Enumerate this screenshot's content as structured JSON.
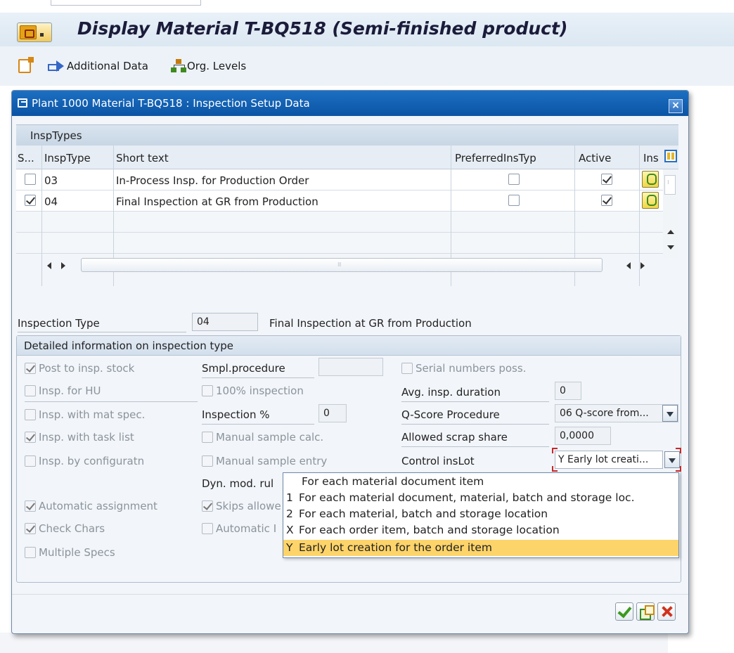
{
  "window": {
    "title": "Display Material T-BQ518 (Semi-finished product)",
    "menu_icon": "sap-menu-icon"
  },
  "toolbar": {
    "items": [
      {
        "icon": "create-document-icon",
        "label": ""
      },
      {
        "icon": "arrow-right-icon",
        "label": "Additional Data"
      },
      {
        "icon": "org-structure-icon",
        "label": "Org. Levels"
      }
    ]
  },
  "dialog": {
    "title": "Plant 1000 Material T-BQ518 : Inspection Setup Data",
    "close_label": "×"
  },
  "table": {
    "title": "InspTypes",
    "columns": [
      "S...",
      "InspType",
      "Short text",
      "PreferredInsTyp",
      "Active",
      "Ins"
    ],
    "rows": [
      {
        "selected": false,
        "insp_type": "03",
        "short_text": "In-Process Insp. for Production Order",
        "preferred": false,
        "active": true
      },
      {
        "selected": true,
        "insp_type": "04",
        "short_text": "Final Inspection at GR from Production",
        "preferred": false,
        "active": true
      }
    ]
  },
  "inspection_type": {
    "label": "Inspection Type",
    "value": "04",
    "description": "Final Inspection at GR from Production"
  },
  "details": {
    "group_title": "Detailed information on inspection type",
    "col1": [
      {
        "label": "Post to insp. stock",
        "checked": true
      },
      {
        "label": "Insp. for HU",
        "checked": false
      },
      {
        "label": "Insp. with mat spec.",
        "checked": false
      },
      {
        "label": "Insp. with task list",
        "checked": true
      },
      {
        "label": "Insp. by configuratn",
        "checked": false
      },
      {
        "label": "Automatic assignment",
        "checked": true
      },
      {
        "label": "Check Chars",
        "checked": true
      },
      {
        "label": "Multiple Specs",
        "checked": false
      }
    ],
    "smpl_procedure": {
      "label": "Smpl.procedure",
      "value": ""
    },
    "inspection_100": {
      "label": "100% inspection",
      "checked": false
    },
    "inspection_pct": {
      "label": "Inspection %",
      "value": "0"
    },
    "manual_sample_calc": {
      "label": "Manual sample calc.",
      "checked": false
    },
    "manual_sample_entry": {
      "label": "Manual sample entry",
      "checked": false
    },
    "dyn_mod_rule": {
      "label": "Dyn. mod. rul"
    },
    "skips_allowed": {
      "label": "Skips allowe",
      "checked": true
    },
    "automatic": {
      "label": "Automatic I",
      "checked": false
    },
    "serial_numbers": {
      "label": "Serial numbers poss.",
      "checked": false
    },
    "avg_insp_duration": {
      "label": "Avg. insp. duration",
      "value": "0"
    },
    "q_score": {
      "label": "Q-Score Procedure",
      "value": "06 Q-score from..."
    },
    "scrap_share": {
      "label": "Allowed scrap share",
      "value": "0,0000"
    },
    "control_inslot": {
      "label": "Control insLot",
      "value": "Y Early lot creati..."
    }
  },
  "control_inslot_options": [
    {
      "key": "",
      "label": "For each material document item",
      "selected": false
    },
    {
      "key": "1",
      "label": "For each material document, material, batch and storage loc.",
      "selected": false
    },
    {
      "key": "2",
      "label": "For each material, batch and storage location",
      "selected": false
    },
    {
      "key": "X",
      "label": "For each order item, batch and storage location",
      "selected": false
    },
    {
      "key": "Y",
      "label": "Early lot creation for the order item",
      "selected": true
    }
  ],
  "colors": {
    "dialog_title": "#0b54a5",
    "highlight": "#fdd46a",
    "focus": "#c8282b"
  }
}
